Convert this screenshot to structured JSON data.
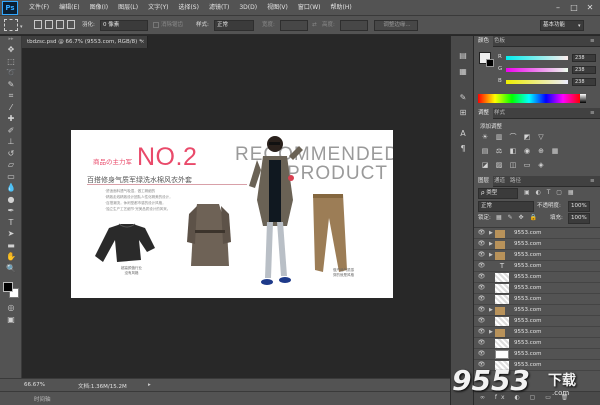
{
  "app": {
    "logo": "Ps"
  },
  "menu": [
    "文件(F)",
    "编辑(E)",
    "图像(I)",
    "图层(L)",
    "文字(Y)",
    "选择(S)",
    "滤镜(T)",
    "3D(D)",
    "视图(V)",
    "窗口(W)",
    "帮助(H)"
  ],
  "window_controls": {
    "minimize": "–",
    "maximize": "□",
    "close": "✕"
  },
  "options": {
    "feather_label": "羽化:",
    "feather_value": "0 像素",
    "antialias_label": "消除锯齿",
    "style_label": "样式:",
    "style_value": "正常",
    "width_label": "宽度:",
    "height_label": "高度:",
    "refine_edge": "调整边缘...",
    "workspace": "基本功能"
  },
  "document": {
    "tab_title": "tbdzsc.psd @ 66.7% (9553.com, RGB/8) *",
    "tab_close": "×"
  },
  "banner": {
    "small_title": "商品の主力军",
    "big_title": "NO.2",
    "subtitle": "百搭修身气质军绿洗水棉风衣外套",
    "body_lines": [
      "·舒适面料透气吸湿，做工精细的",
      "·精致走线精致设计团队人性化精美的设计，",
      "·百搭潮流，休闲型都市感的设计风格，",
      "·独立生产工艺细节·完美品质设计的风采。"
    ],
    "watermark_top": "RECOMMENDED",
    "watermark_bottom": "PRODUCT",
    "tag_left": "超高颜值行业\n没有风格",
    "tag_right": "做产品气质感\n穿的就是风格"
  },
  "status": {
    "zoom": "66.67%",
    "doc_size": "文档:1.36M/15.2M",
    "timeline": "时间轴"
  },
  "color_panel": {
    "tabs": [
      "颜色",
      "色板"
    ],
    "channels": [
      {
        "name": "R",
        "value": "238"
      },
      {
        "name": "G",
        "value": "238"
      },
      {
        "name": "B",
        "value": "238"
      }
    ]
  },
  "adjust_panel": {
    "tabs": [
      "调整",
      "样式"
    ],
    "title": "添加调整"
  },
  "layers_panel": {
    "tabs": [
      "图层",
      "通道",
      "路径"
    ],
    "filter_value": "ρ 类型",
    "blend_mode": "正常",
    "opacity_label": "不透明度:",
    "opacity_value": "100%",
    "lock_label": "锁定:",
    "fill_label": "填充:",
    "fill_value": "100%",
    "layers": [
      {
        "name": "9553.com",
        "kind": "folder"
      },
      {
        "name": "9553.com",
        "kind": "folder"
      },
      {
        "name": "9553.com",
        "kind": "folder"
      },
      {
        "name": "9553.com",
        "kind": "text"
      },
      {
        "name": "9553.com",
        "kind": "pixel"
      },
      {
        "name": "9553.com",
        "kind": "pixel"
      },
      {
        "name": "9553.com",
        "kind": "pixel"
      },
      {
        "name": "9553.com",
        "kind": "folder"
      },
      {
        "name": "9553.com",
        "kind": "pixel"
      },
      {
        "name": "9553.com",
        "kind": "folder"
      },
      {
        "name": "9553.com",
        "kind": "pixel"
      },
      {
        "name": "9553.com",
        "kind": "image"
      },
      {
        "name": "9553.com",
        "kind": "pixel"
      }
    ]
  },
  "site_watermark": {
    "number": "9553",
    "suffix": "下载",
    "small": ".com"
  },
  "colors": {
    "banner_pink": "#e94a6a",
    "banner_gray": "#9a9a9a",
    "panel_bg": "#535353",
    "canvas_bg": "#282828",
    "ps_blue": "#31a8ff"
  }
}
